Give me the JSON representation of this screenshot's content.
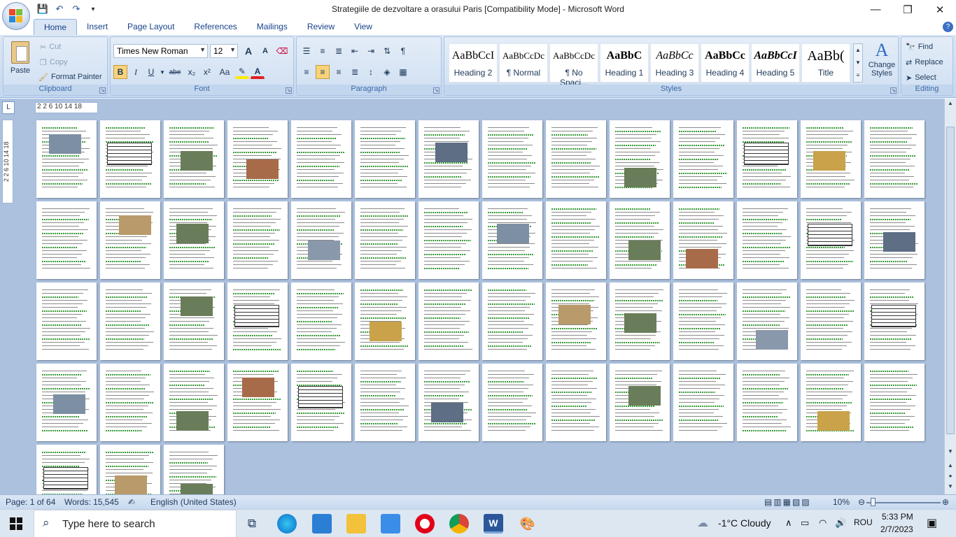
{
  "window": {
    "title": "Strategiile de dezvoltare a orasului Paris [Compatibility Mode] - Microsoft Word",
    "minimize": "—",
    "restore": "❐",
    "close": "✕"
  },
  "qat": {
    "save": "💾",
    "undo": "↶",
    "redo": "↷",
    "customize": "▾"
  },
  "tabs": [
    "Home",
    "Insert",
    "Page Layout",
    "References",
    "Mailings",
    "Review",
    "View"
  ],
  "help": "?",
  "ribbon": {
    "clipboard": {
      "label": "Clipboard",
      "paste": "Paste",
      "cut": "Cut",
      "copy": "Copy",
      "format_painter": "Format Painter"
    },
    "font": {
      "label": "Font",
      "family": "Times New Roman",
      "size": "12",
      "grow": "A",
      "shrink": "A",
      "bold": "B",
      "italic": "I",
      "underline": "U",
      "strike": "abe",
      "subscript": "x₂",
      "superscript": "x²",
      "change_case": "Aa"
    },
    "paragraph": {
      "label": "Paragraph"
    },
    "styles": {
      "label": "Styles",
      "items": [
        {
          "sample": "AaBbCcI",
          "name": "Heading 2"
        },
        {
          "sample": "AaBbCcDc",
          "name": "¶ Normal"
        },
        {
          "sample": "AaBbCcDc",
          "name": "¶ No Spaci..."
        },
        {
          "sample": "AaBbC",
          "name": "Heading 1"
        },
        {
          "sample": "AaBbCc",
          "name": "Heading 3"
        },
        {
          "sample": "AaBbCc",
          "name": "Heading 4"
        },
        {
          "sample": "AaBbCcI",
          "name": "Heading 5"
        },
        {
          "sample": "AaBb(",
          "name": "Title"
        }
      ],
      "change_styles": "Change Styles"
    },
    "editing": {
      "label": "Editing",
      "find": "Find",
      "replace": "Replace",
      "select": "Select"
    }
  },
  "ruler": {
    "h_ticks": "2  2   6  10  14  18",
    "v_ticks": "2  2  6  10  14  18"
  },
  "status": {
    "page": "Page: 1 of 64",
    "words": "Words: 15,545",
    "language": "English (United States)",
    "zoom": "10%"
  },
  "taskbar": {
    "search_placeholder": "Type here to search",
    "weather": "-1°C  Cloudy",
    "lang": "ROU",
    "time": "5:33 PM",
    "date": "2/7/2023"
  },
  "colors": {
    "accent": "#2b579a",
    "ribbon_bg": "#c5d8ef",
    "doc_bg": "#abc1de"
  }
}
